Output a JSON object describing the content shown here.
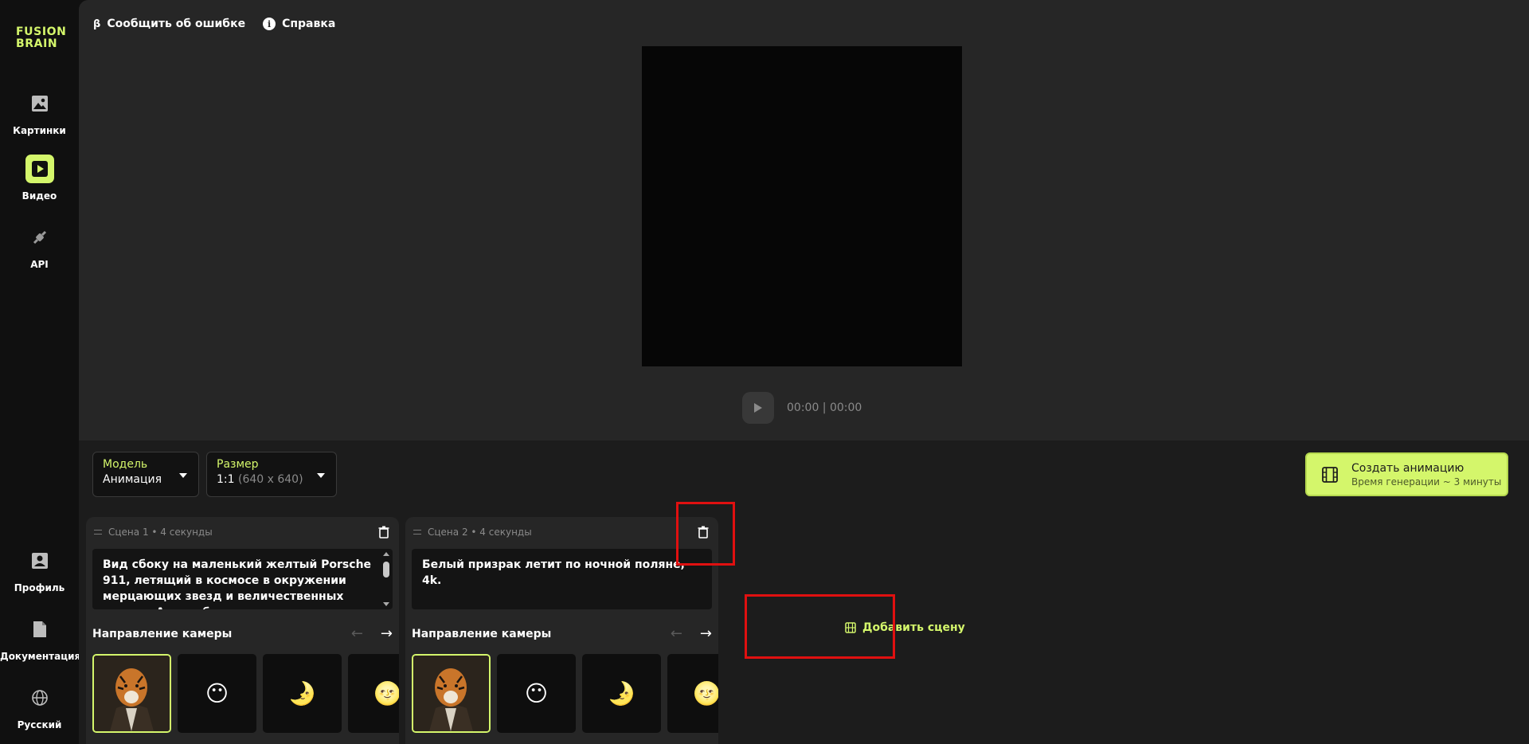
{
  "sidebar": {
    "logo_line1": "FUSION",
    "logo_line2": "BRAIN",
    "items": [
      {
        "label": "Картинки",
        "icon": "image-icon"
      },
      {
        "label": "Видео",
        "icon": "play-icon"
      },
      {
        "label": "API",
        "icon": "plug-icon"
      },
      {
        "label": "Профиль",
        "icon": "profile-icon"
      },
      {
        "label": "Документация",
        "icon": "document-icon"
      },
      {
        "label": "Русский",
        "icon": "globe-icon"
      }
    ]
  },
  "header": {
    "beta_mark": "β",
    "report_label": "Сообщить об ошибке",
    "info_mark": "i",
    "help_label": "Справка"
  },
  "player": {
    "time": "00:00 | 00:00"
  },
  "model_select": {
    "label": "Модель",
    "value": "Анимация"
  },
  "size_select": {
    "label": "Размер",
    "value": "1:1",
    "detail": "(640 x 640)"
  },
  "create_button": {
    "title": "Создать анимацию",
    "subtitle": "Время генерации ~ 3 минуты"
  },
  "scenes": [
    {
      "header": "Сцена 1 • 4 секунды",
      "prompt": "Вид сбоку на маленький желтый Porsche 911, летящий в космосе в окружении мерцающих звезд и величественных планет. Автомобиль",
      "camera_label": "Направление камеры"
    },
    {
      "header": "Сцена 2 • 4 секунды",
      "prompt": "Белый призрак летит по ночной поляне, 4k.",
      "camera_label": "Направление камеры"
    }
  ],
  "add_scene_label": "Добавить сцену",
  "colors": {
    "accent": "#d4f66b",
    "highlight": "#e01010"
  }
}
